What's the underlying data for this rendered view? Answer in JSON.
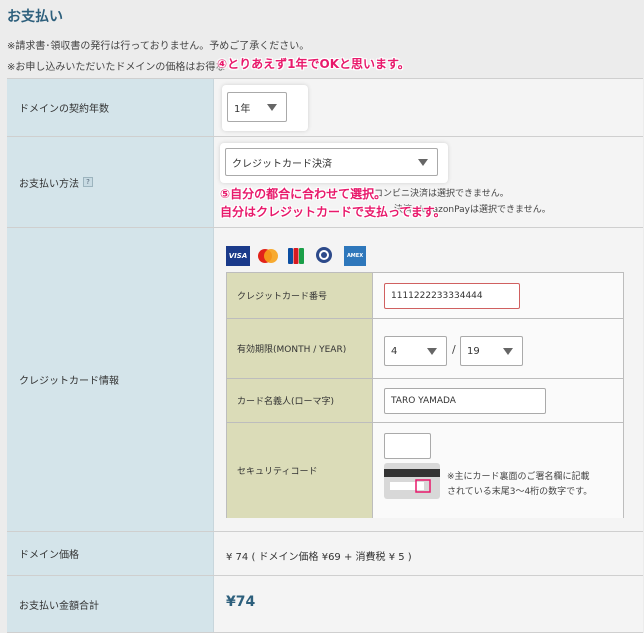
{
  "section": {
    "title": "お支払い",
    "note_invoice": "※請求書･領収書の発行は行っておりません。予めご了承ください。",
    "note_price": "※お申し込みいただいたドメインの価格はお得な"
  },
  "annotations": {
    "a4": "④とりあえず1年でOKと思います。",
    "a5_line1": "⑤自分の都合に合わせて選択。",
    "a5_line2": "自分はクレジットカードで支払ってます。"
  },
  "term": {
    "label": "ドメインの契約年数",
    "selected": "1年"
  },
  "payment_method": {
    "label": "お支払い方法",
    "help_icon": "?",
    "selected": "クレジットカード決済",
    "note_line1": "コンビニ決済は選択できません。",
    "note_line2": "決済, AmazonPayは選択できません。"
  },
  "card": {
    "label": "クレジットカード情報",
    "brands": [
      "VISA",
      "mastercard",
      "JCB",
      "Diners Club",
      "AMEX"
    ],
    "number_label": "クレジットカード番号",
    "number_value": "1111222233334444",
    "expiry_label": "有効期限(MONTH / YEAR)",
    "expiry_month": "4",
    "expiry_separator": "/",
    "expiry_year": "19",
    "holder_label": "カード名義人(ローマ字)",
    "holder_value": "TARO YAMADA",
    "cvv_label": "セキュリティコード",
    "cvv_value": "",
    "cvv_note_line1": "※主にカード裏面のご署名欄に記載",
    "cvv_note_line2": "されている末尾3〜4桁の数字です。"
  },
  "price": {
    "label": "ドメイン価格",
    "value": "¥ 74 ( ドメイン価格 ¥69 + 消費税 ¥ 5 )"
  },
  "total": {
    "label": "お支払い金額合計",
    "value": "¥74"
  },
  "colors": {
    "accent_annotation": "#e8196b",
    "header_blue": "#2d5f7c",
    "label_bg": "#d4e4ea",
    "inner_label_bg": "#dbdcb8"
  }
}
